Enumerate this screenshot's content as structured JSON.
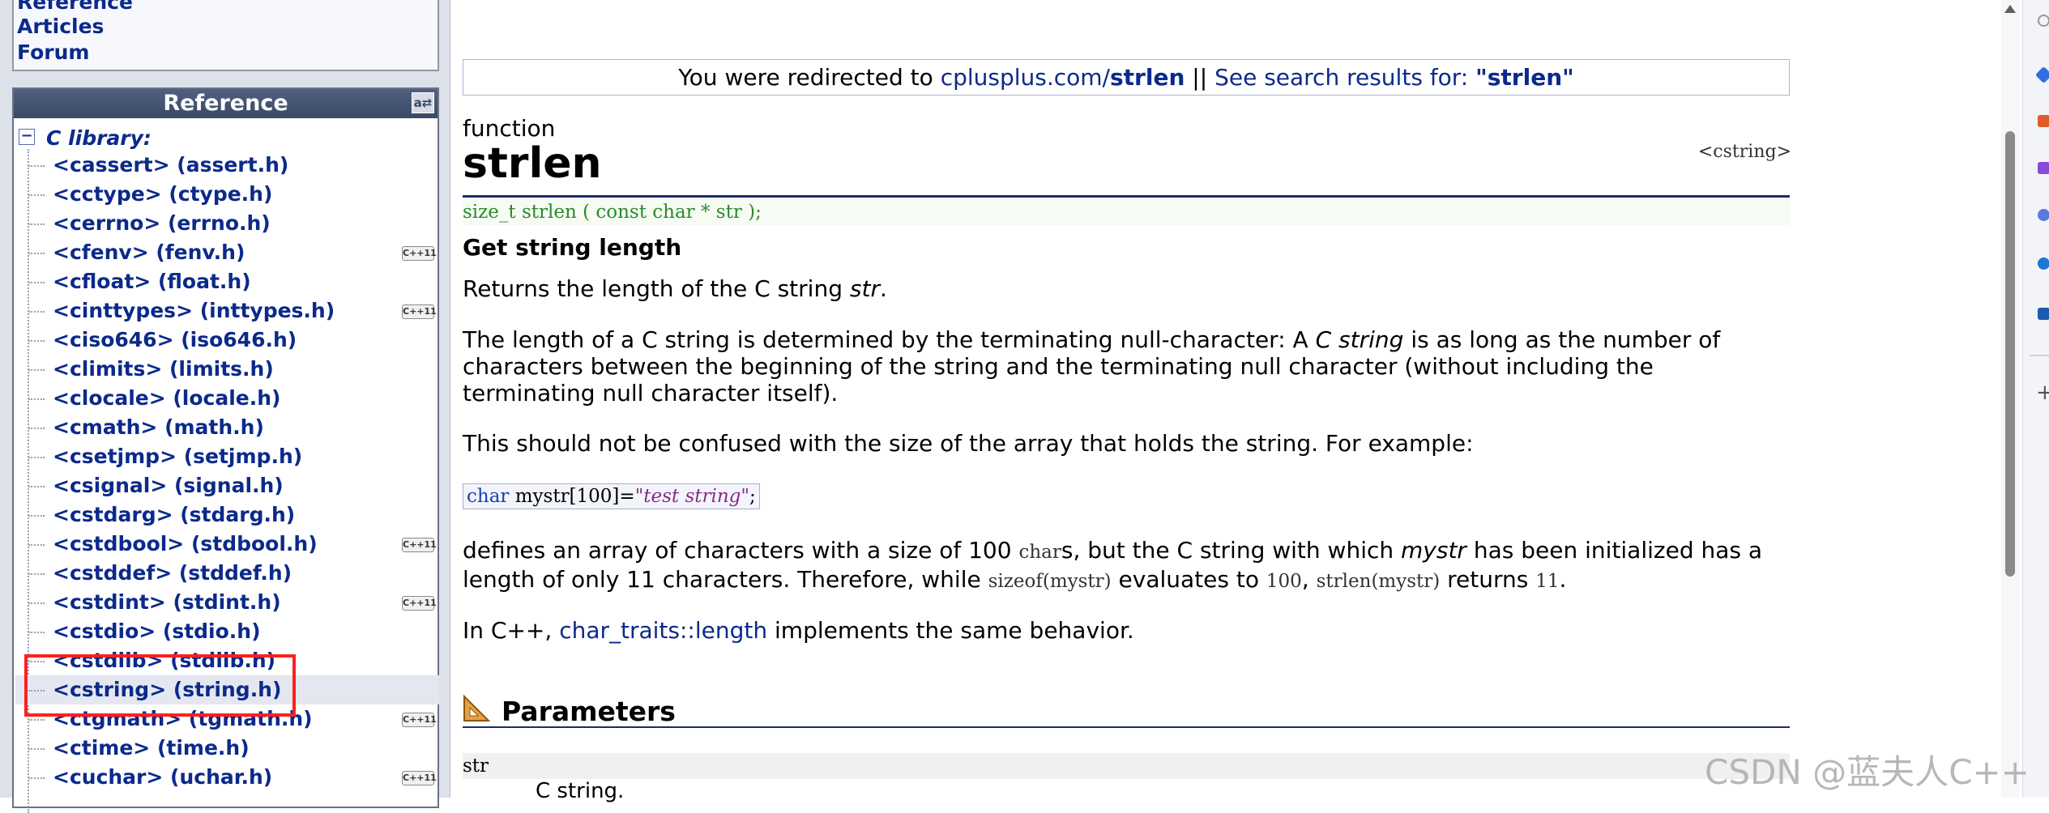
{
  "topnav": {
    "items": [
      "Reference",
      "Articles",
      "Forum"
    ]
  },
  "reference_panel": {
    "title": "Reference",
    "clib_label": "C library:",
    "headers": [
      {
        "label": "<cassert> (assert.h)",
        "cpp": false
      },
      {
        "label": "<cctype> (ctype.h)",
        "cpp": false
      },
      {
        "label": "<cerrno> (errno.h)",
        "cpp": false
      },
      {
        "label": "<cfenv> (fenv.h)",
        "cpp": true
      },
      {
        "label": "<cfloat> (float.h)",
        "cpp": false
      },
      {
        "label": "<cinttypes> (inttypes.h)",
        "cpp": true
      },
      {
        "label": "<ciso646> (iso646.h)",
        "cpp": false
      },
      {
        "label": "<climits> (limits.h)",
        "cpp": false
      },
      {
        "label": "<clocale> (locale.h)",
        "cpp": false
      },
      {
        "label": "<cmath> (math.h)",
        "cpp": false
      },
      {
        "label": "<csetjmp> (setjmp.h)",
        "cpp": false
      },
      {
        "label": "<csignal> (signal.h)",
        "cpp": false
      },
      {
        "label": "<cstdarg> (stdarg.h)",
        "cpp": false
      },
      {
        "label": "<cstdbool> (stdbool.h)",
        "cpp": true
      },
      {
        "label": "<cstddef> (stddef.h)",
        "cpp": false
      },
      {
        "label": "<cstdint> (stdint.h)",
        "cpp": true
      },
      {
        "label": "<cstdio> (stdio.h)",
        "cpp": false
      },
      {
        "label": "<cstdlib> (stdlib.h)",
        "cpp": false
      },
      {
        "label": "<cstring> (string.h)",
        "cpp": false,
        "selected": true
      },
      {
        "label": "<ctgmath> (tgmath.h)",
        "cpp": true
      },
      {
        "label": "<ctime> (time.h)",
        "cpp": false
      },
      {
        "label": "<cuchar> (uchar.h)",
        "cpp": true
      }
    ],
    "cpp_badge": "C++11"
  },
  "redirect": {
    "prefix": "You were redirected to ",
    "url_base": "cplusplus.com/",
    "url_term": "strlen",
    "separator": " || ",
    "search_text": "See search results for: ",
    "search_term": "\"strlen\""
  },
  "doc": {
    "kind": "function",
    "name": "strlen",
    "header": "<cstring>",
    "prototype": "size_t strlen ( const char * str );",
    "subtitle": "Get string length",
    "p1_text": "Returns the length of the C string ",
    "p1_em": "str",
    "p1_end": ".",
    "p2_a": "The length of a C string is determined by the terminating null-character: A ",
    "p2_em": "C string",
    "p2_b": " is as long as the number of characters between the beginning of the string and the terminating null character (without including the terminating null character itself).",
    "p3": "This should not be confused with the size of the array that holds the string. For example:",
    "code_kw": "char",
    "code_mid": " mystr[100]=",
    "code_str": "\"test string\"",
    "code_end": ";",
    "p4_a": "defines an array of characters with a size of 100 ",
    "p4_code1": "char",
    "p4_b": "s, but the C string with which ",
    "p4_em": "mystr",
    "p4_c": " has been initialized has a length of only 11 characters. Therefore, while ",
    "p4_code2": "sizeof(mystr)",
    "p4_d": " evaluates to ",
    "p4_code3": "100",
    "p4_e": ", ",
    "p4_code4": "strlen(mystr)",
    "p4_f": " returns ",
    "p4_code5": "11",
    "p4_g": ".",
    "p5_a": "In C++, ",
    "p5_link": "char_traits::length",
    "p5_b": " implements the same behavior.",
    "params_title": "Parameters",
    "param_name": "str",
    "param_desc": "C string."
  },
  "watermark": "CSDN @蓝夫人C++"
}
